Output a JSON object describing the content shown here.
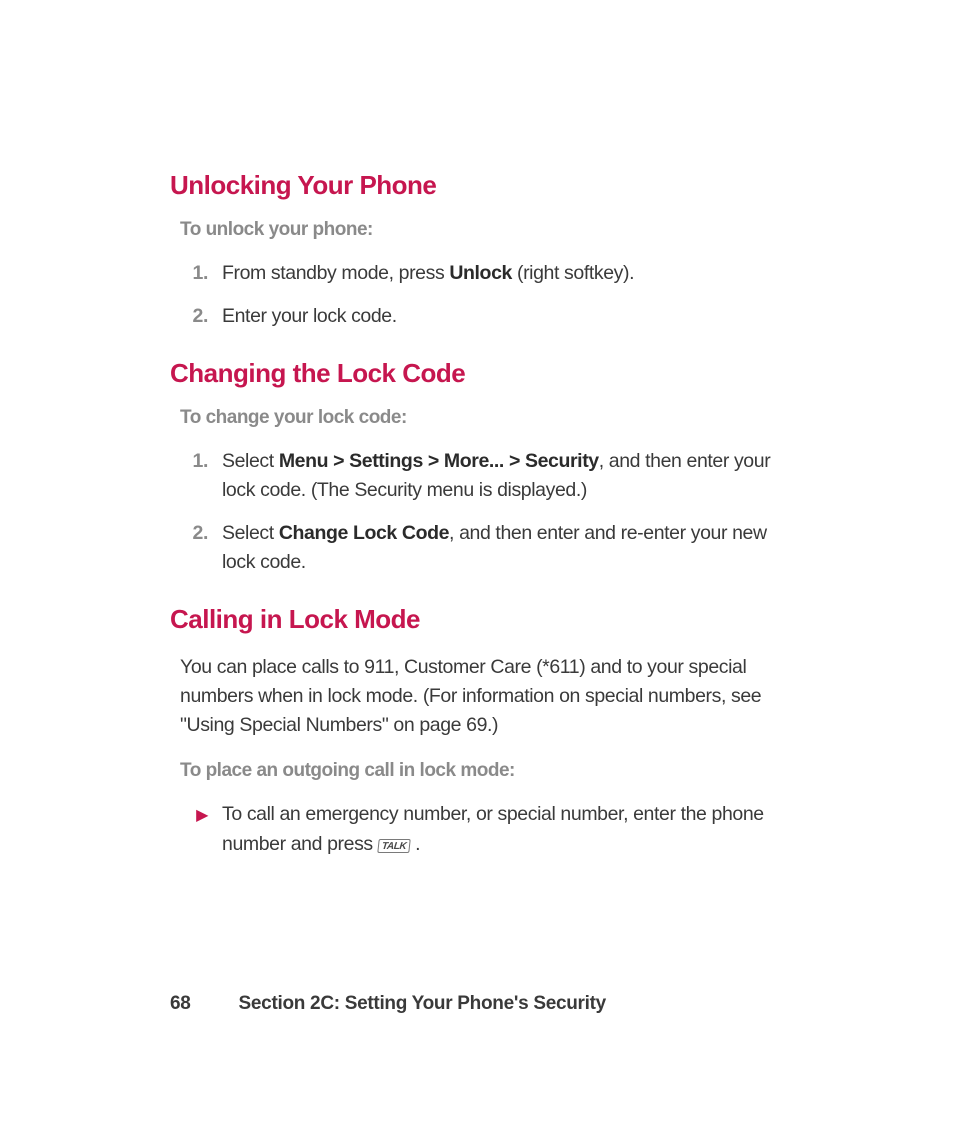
{
  "sections": {
    "unlock": {
      "heading": "Unlocking Your Phone",
      "sub": "To unlock your phone:",
      "step1_num": "1.",
      "step1_pre": "From standby mode, press ",
      "step1_bold": "Unlock",
      "step1_post": " (right softkey).",
      "step2_num": "2.",
      "step2": "Enter your lock code."
    },
    "change": {
      "heading": "Changing the Lock Code",
      "sub": "To change your lock code:",
      "step1_num": "1.",
      "step1_pre": "Select ",
      "step1_bold": "Menu > Settings > More... > Security",
      "step1_post": ", and then enter your lock code. (The Security menu is displayed.)",
      "step2_num": "2.",
      "step2_pre": "Select ",
      "step2_bold": "Change Lock Code",
      "step2_post": ", and then enter and re-enter your new lock code."
    },
    "lockmode": {
      "heading": "Calling in Lock Mode",
      "para": "You can place calls to 911, Customer Care (*611) and to your special numbers when in lock mode. (For information on special numbers, see \"Using Special Numbers\" on page 69.)",
      "sub": "To place an outgoing call in lock mode:",
      "bullet_marker": "▶",
      "bullet_pre": "To call an emergency number, or special number, enter the phone number and press  ",
      "bullet_icon": "TALK",
      "bullet_post": " ."
    }
  },
  "footer": {
    "page": "68",
    "section": "Section 2C: Setting Your Phone's Security"
  }
}
